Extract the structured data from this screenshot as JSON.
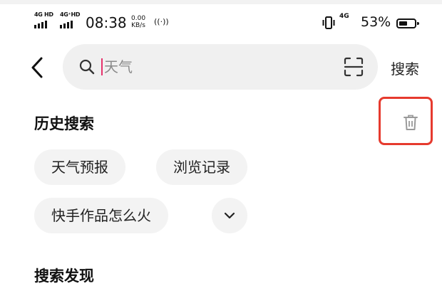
{
  "status_bar": {
    "sim1_label": "4G HD",
    "sim2_label": "4G⁺HD",
    "time": "08:38",
    "speed_value": "0.00",
    "speed_unit": "KB/s",
    "hotspot": "((·))",
    "network": "4G",
    "battery_percent": "53%",
    "battery_level": 0.53
  },
  "search": {
    "placeholder": "天气",
    "submit_label": "搜索"
  },
  "history": {
    "title": "历史搜索",
    "items": [
      "天气预报",
      "浏览记录",
      "快手作品怎么火"
    ]
  },
  "discover": {
    "title": "搜索发现"
  },
  "colors": {
    "accent_cursor": "#e6336c",
    "highlight_box": "#e63a2e",
    "chip_bg": "#f3f3f3",
    "search_bg": "#f0f0f0"
  }
}
